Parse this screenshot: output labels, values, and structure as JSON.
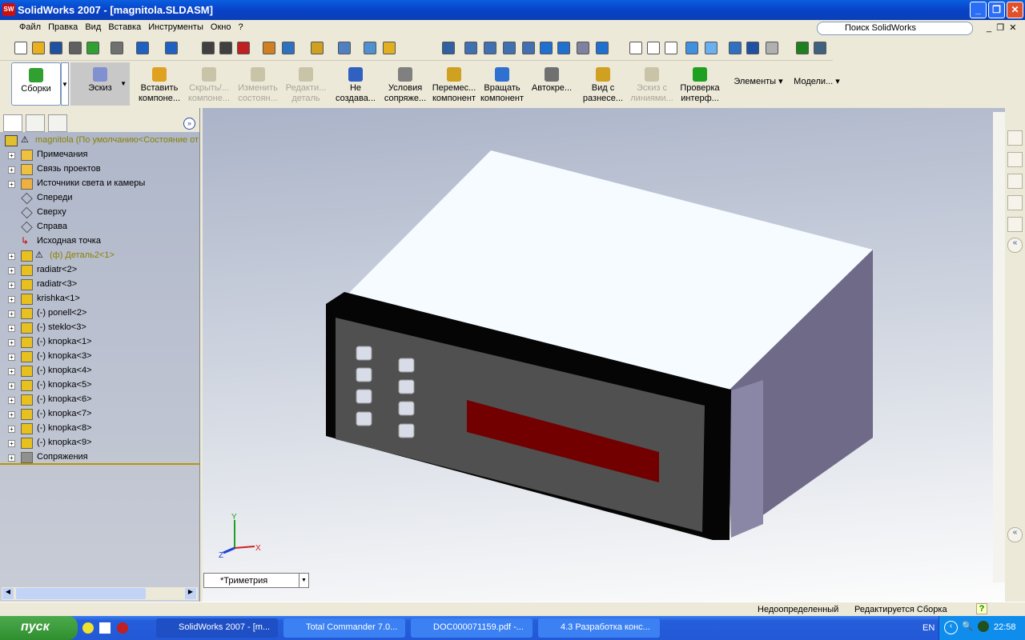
{
  "window": {
    "title": "SolidWorks 2007 - [magnitola.SLDASM]",
    "logo": "SW"
  },
  "menu": [
    "Файл",
    "Правка",
    "Вид",
    "Вставка",
    "Инструменты",
    "Окно",
    "?"
  ],
  "search": {
    "placeholder": "Поиск SolidWorks"
  },
  "command_manager": {
    "groups": [
      {
        "label": "Сборки",
        "active": true
      },
      {
        "label": "Эскиз",
        "active": false
      }
    ],
    "buttons": [
      {
        "label1": "Вставить",
        "label2": "компоне...",
        "enabled": true,
        "color": "#e0a020"
      },
      {
        "label1": "Скрыть/...",
        "label2": "компоне...",
        "enabled": false,
        "color": "#c9c3a8"
      },
      {
        "label1": "Изменить",
        "label2": "состоян...",
        "enabled": false,
        "color": "#c9c3a8"
      },
      {
        "label1": "Редакти...",
        "label2": "деталь",
        "enabled": false,
        "color": "#c9c3a8"
      },
      {
        "label1": "Не",
        "label2": "создава...",
        "enabled": true,
        "color": "#3060c0"
      },
      {
        "label1": "Условия",
        "label2": "сопряже...",
        "enabled": true,
        "color": "#808080"
      },
      {
        "label1": "Перемес...",
        "label2": "компонент",
        "enabled": true,
        "color": "#d0a020"
      },
      {
        "label1": "Вращать",
        "label2": "компонент",
        "enabled": true,
        "color": "#3070d0"
      },
      {
        "label1": "Автокре...",
        "label2": "",
        "enabled": true,
        "color": "#707070"
      },
      {
        "label1": "Вид с",
        "label2": "разнесе...",
        "enabled": true,
        "color": "#d0a020"
      },
      {
        "label1": "Эскиз с",
        "label2": "линиями...",
        "enabled": false,
        "color": "#c9c3a8"
      },
      {
        "label1": "Проверка",
        "label2": "интерф...",
        "enabled": true,
        "color": "#20a020"
      }
    ],
    "dropdowns": [
      {
        "label": "Элементы"
      },
      {
        "label": "Модели..."
      }
    ]
  },
  "tree": {
    "root": "magnitola  (По умолчанию<Состояние от",
    "items": [
      {
        "label": "Примечания",
        "expand": true,
        "icon": "annotations",
        "warn": false
      },
      {
        "label": "Связь проектов",
        "expand": true,
        "icon": "design-binder",
        "warn": false
      },
      {
        "label": "Источники света и камеры",
        "expand": true,
        "icon": "lights",
        "warn": false
      },
      {
        "label": "Спереди",
        "expand": false,
        "icon": "plane",
        "warn": false
      },
      {
        "label": "Сверху",
        "expand": false,
        "icon": "plane",
        "warn": false
      },
      {
        "label": "Справа",
        "expand": false,
        "icon": "plane",
        "warn": false
      },
      {
        "label": "Исходная точка",
        "expand": false,
        "icon": "origin",
        "warn": false
      },
      {
        "label": "(ф) Деталь2<1>",
        "expand": true,
        "icon": "part",
        "warn": true
      },
      {
        "label": "radiatr<2>",
        "expand": true,
        "icon": "part",
        "warn": false
      },
      {
        "label": "radiatr<3>",
        "expand": true,
        "icon": "part",
        "warn": false
      },
      {
        "label": "krishka<1>",
        "expand": true,
        "icon": "part",
        "warn": false
      },
      {
        "label": "(-) ponell<2>",
        "expand": true,
        "icon": "part",
        "warn": false
      },
      {
        "label": "(-) steklo<3>",
        "expand": true,
        "icon": "part",
        "warn": false
      },
      {
        "label": "(-) knopka<1>",
        "expand": true,
        "icon": "part",
        "warn": false
      },
      {
        "label": "(-) knopka<3>",
        "expand": true,
        "icon": "part",
        "warn": false
      },
      {
        "label": "(-) knopka<4>",
        "expand": true,
        "icon": "part",
        "warn": false
      },
      {
        "label": "(-) knopka<5>",
        "expand": true,
        "icon": "part",
        "warn": false
      },
      {
        "label": "(-) knopka<6>",
        "expand": true,
        "icon": "part",
        "warn": false
      },
      {
        "label": "(-) knopka<7>",
        "expand": true,
        "icon": "part",
        "warn": false
      },
      {
        "label": "(-) knopka<8>",
        "expand": true,
        "icon": "part",
        "warn": false
      },
      {
        "label": "(-) knopka<9>",
        "expand": true,
        "icon": "part",
        "warn": false
      },
      {
        "label": "Сопряжения",
        "expand": true,
        "icon": "mates",
        "warn": false
      }
    ]
  },
  "viewport": {
    "view_orientation": "*Триметрия",
    "axes": {
      "x": "X",
      "y": "Y",
      "z": "Z"
    }
  },
  "status": {
    "state": "Недоопределенный",
    "mode": "Редактируется Сборка",
    "help": "?"
  },
  "taskbar": {
    "start": "пуск",
    "tasks": [
      {
        "label": "SolidWorks 2007 - [m...",
        "active": true
      },
      {
        "label": "Total Commander 7.0...",
        "active": false
      },
      {
        "label": "DOC000071159.pdf -...",
        "active": false
      },
      {
        "label": "4.3 Разработка конс...",
        "active": false
      }
    ],
    "lang": "EN",
    "clock": "22:58"
  }
}
